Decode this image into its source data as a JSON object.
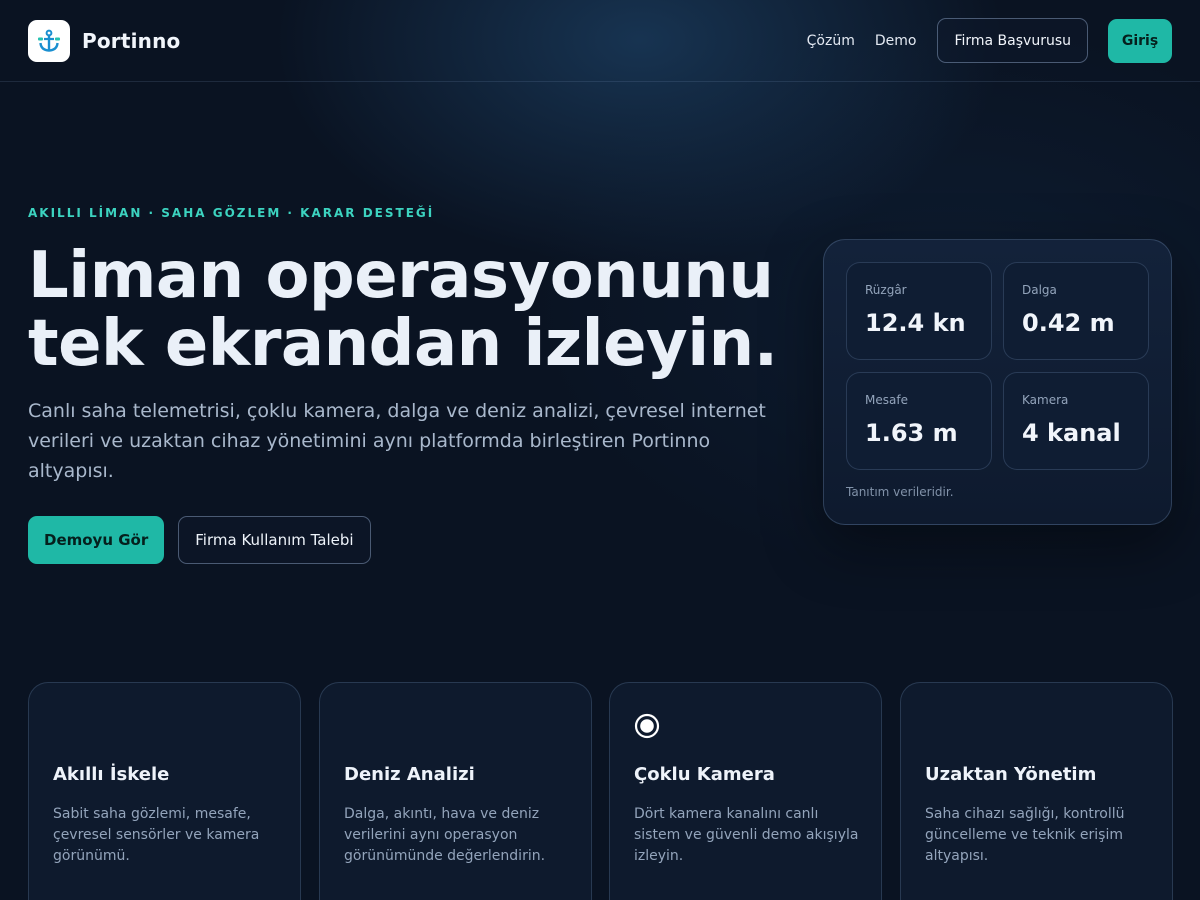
{
  "header": {
    "brand_name": "Portinno",
    "logo_icon": "anchor-icon",
    "nav": {
      "cozum": "Çözüm",
      "demo": "Demo",
      "firma_basvurusu": "Firma Başvurusu",
      "giris": "Giriş"
    }
  },
  "hero": {
    "eyebrow": "AKILLI LİMAN · SAHA GÖZLEM · KARAR DESTEĞİ",
    "title_line1": "Liman operasyonunu",
    "title_line2": "tek ekrandan izleyin.",
    "description": "Canlı saha telemetrisi, çoklu kamera, dalga ve deniz analizi, çevresel internet verileri ve uzaktan cihaz yönetimini aynı platformda birleştiren Portinno altyapısı.",
    "primary_button": "Demoyu Gör",
    "secondary_button": "Firma Kullanım Talebi"
  },
  "telemetry": {
    "stats": [
      {
        "label": "Rüzgâr",
        "value": "12.4 kn"
      },
      {
        "label": "Dalga",
        "value": "0.42 m"
      },
      {
        "label": "Mesafe",
        "value": "1.63 m"
      },
      {
        "label": "Kamera",
        "value": "4 kanal"
      }
    ],
    "note": "Tanıtım verileridir."
  },
  "features": [
    {
      "title": "Akıllı İskele",
      "description": "Sabit saha gözlemi, mesafe, çevresel sensörler ve kamera görünümü."
    },
    {
      "title": "Deniz Analizi",
      "description": "Dalga, akıntı, hava ve deniz verilerini aynı operasyon görünümünde değerlendirin."
    },
    {
      "title": "Çoklu Kamera",
      "description": "Dört kamera kanalını canlı sistem ve güvenli demo akışıyla izleyin.",
      "icon": "radio-button-icon"
    },
    {
      "title": "Uzaktan Yönetim",
      "description": "Saha cihazı sağlığı, kontrollü güncelleme ve teknik erişim altyapısı."
    }
  ],
  "colors": {
    "accent": "#1fb8a6",
    "eyebrow": "#3cd3c0",
    "background": "#0a1322"
  }
}
